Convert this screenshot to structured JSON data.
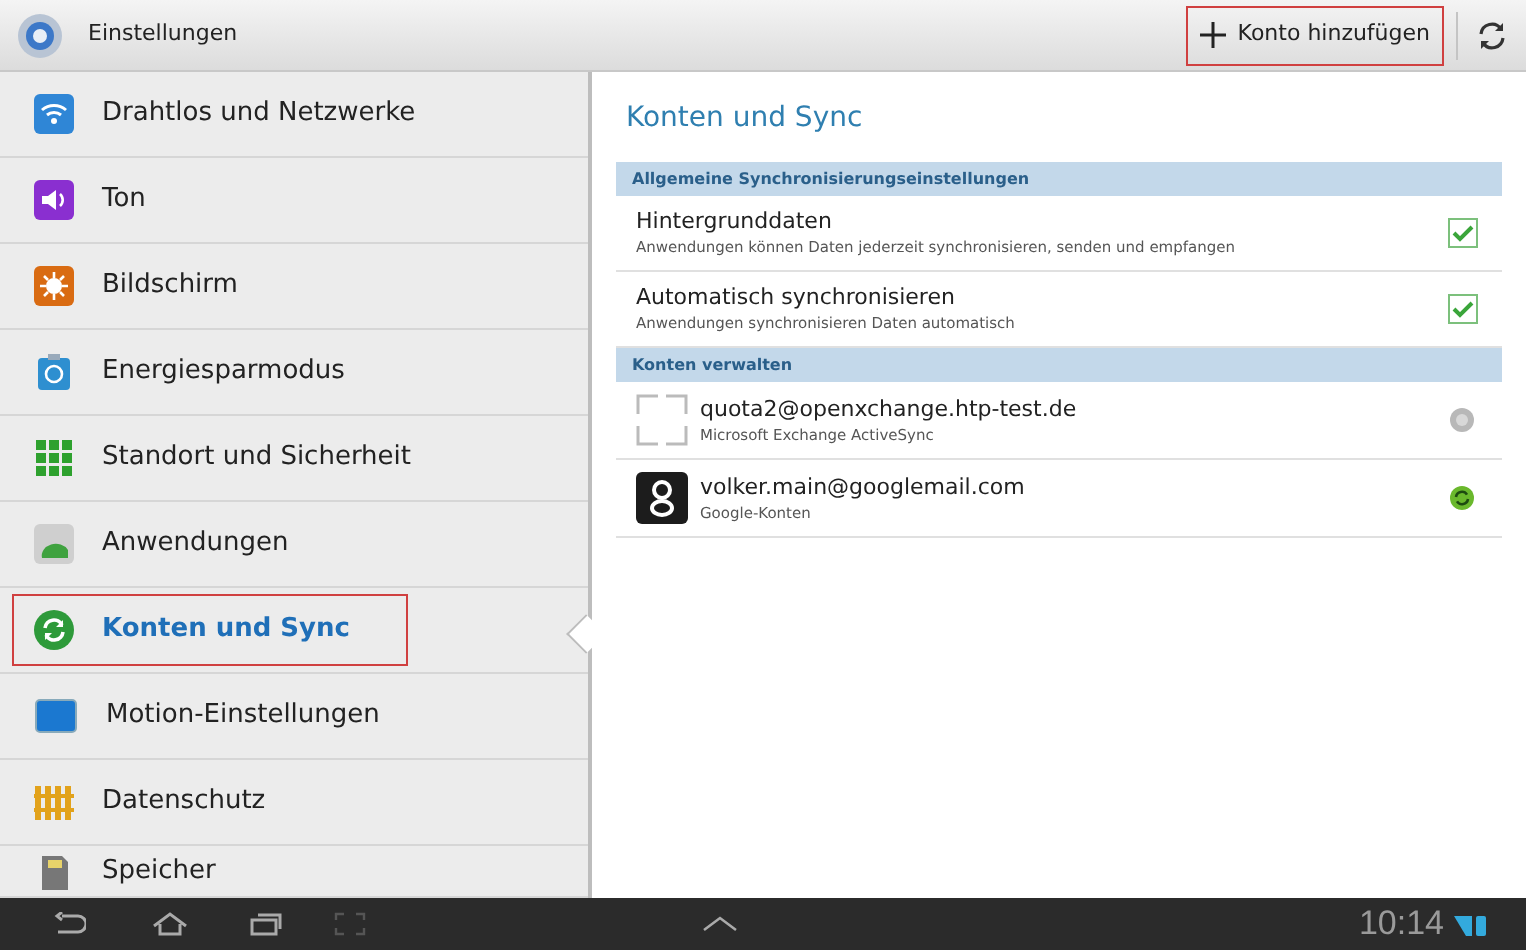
{
  "app_bar": {
    "title": "Einstellungen",
    "action": {
      "label": "Konto hinzufügen",
      "highlighted": true
    }
  },
  "sidebar": {
    "items": [
      {
        "label": "Drahtlos und Netzwerke",
        "kind": "wifi",
        "selected": false
      },
      {
        "label": "Ton",
        "kind": "sound",
        "selected": false
      },
      {
        "label": "Bildschirm",
        "kind": "display",
        "selected": false
      },
      {
        "label": "Energiesparmodus",
        "kind": "power",
        "selected": false
      },
      {
        "label": "Standort und Sicherheit",
        "kind": "location",
        "selected": false
      },
      {
        "label": "Anwendungen",
        "kind": "apps",
        "selected": false
      },
      {
        "label": "Konten und Sync",
        "kind": "sync",
        "selected": true
      },
      {
        "label": "Motion-Einstellungen",
        "kind": "motion",
        "selected": false
      },
      {
        "label": "Datenschutz",
        "kind": "privacy",
        "selected": false
      },
      {
        "label": "Speicher",
        "kind": "storage",
        "selected": false
      }
    ]
  },
  "panel": {
    "title": "Konten und Sync",
    "sections": [
      {
        "header": "Allgemeine Synchronisierungseinstellungen",
        "kind": "settings",
        "rows": [
          {
            "title": "Hintergrunddaten",
            "subtitle": "Anwendungen können Daten jederzeit synchronisieren, senden und empfangen",
            "checked": true
          },
          {
            "title": "Automatisch synchronisieren",
            "subtitle": "Anwendungen synchronisieren Daten automatisch",
            "checked": true
          }
        ]
      },
      {
        "header": "Konten verwalten",
        "kind": "accounts",
        "rows": [
          {
            "title": "quota2@openxchange.htp-test.de",
            "subtitle": "Microsoft Exchange ActiveSync",
            "kind": "exchange",
            "sync_on": false
          },
          {
            "title": "volker.main@googlemail.com",
            "subtitle": "Google-Konten",
            "kind": "google",
            "sync_on": true
          }
        ]
      }
    ]
  },
  "status_bar": {
    "time": "10:14"
  }
}
